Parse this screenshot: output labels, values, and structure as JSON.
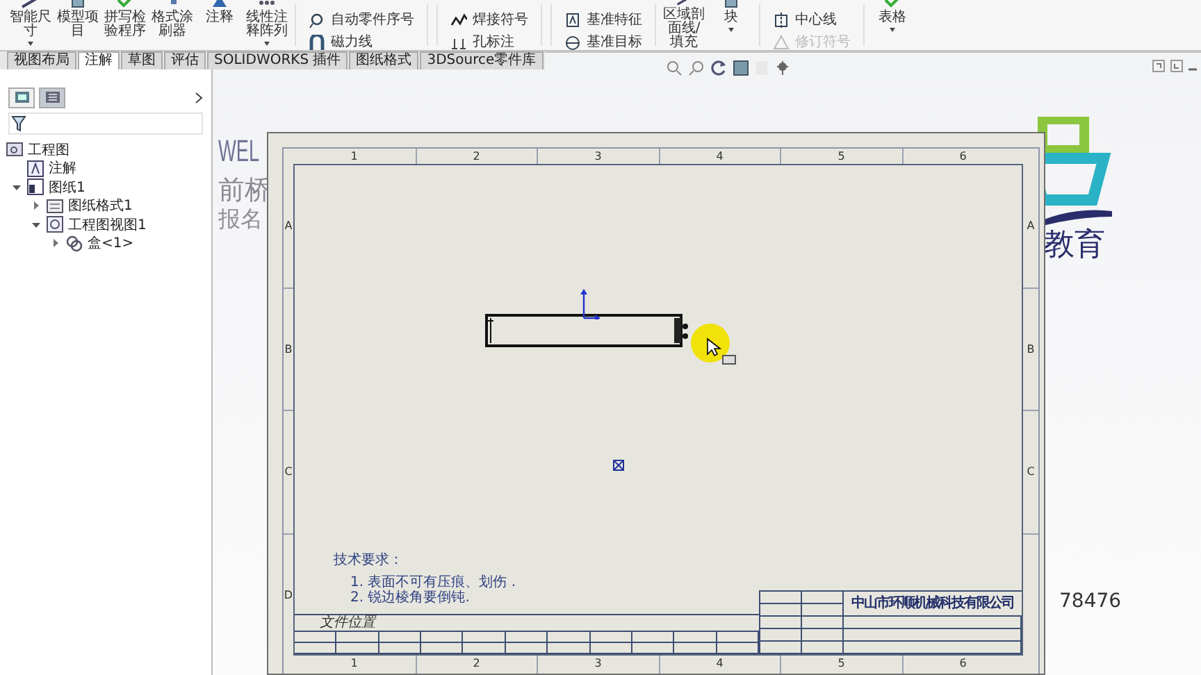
{
  "ribbon": [
    {
      "kind": "large",
      "label": "智能尺寸",
      "dropdown": true
    },
    {
      "kind": "large",
      "label": "模型项目",
      "dropdown": false
    },
    {
      "kind": "large",
      "label": "拼写检验程序",
      "dropdown": false
    },
    {
      "kind": "large",
      "label": "格式涂刷器",
      "dropdown": false
    },
    {
      "kind": "large",
      "label": "注释",
      "dropdown": false
    },
    {
      "kind": "large",
      "label": "线性注释阵列",
      "dropdown": true
    },
    {
      "kind": "stack",
      "items": [
        {
          "label": "自动零件序号",
          "disabled": false
        },
        {
          "label": "磁力线",
          "disabled": false
        }
      ]
    },
    {
      "kind": "stack",
      "items": [
        {
          "label": "焊接符号",
          "disabled": false
        },
        {
          "label": "孔标注",
          "disabled": false
        }
      ]
    },
    {
      "kind": "stack",
      "items": [
        {
          "label": "基准特征",
          "disabled": false
        },
        {
          "label": "基准目标",
          "disabled": false
        }
      ]
    },
    {
      "kind": "large",
      "label": "区域剖面线/填充",
      "dropdown": false
    },
    {
      "kind": "large",
      "label": "块",
      "dropdown": true
    },
    {
      "kind": "stack",
      "items": [
        {
          "label": "中心线",
          "disabled": false
        },
        {
          "label": "修订符号",
          "disabled": true
        }
      ]
    },
    {
      "kind": "large",
      "label": "表格",
      "dropdown": true
    }
  ],
  "tabs": [
    {
      "label": "视图布局",
      "selected": false
    },
    {
      "label": "注解",
      "selected": true
    },
    {
      "label": "草图",
      "selected": false
    },
    {
      "label": "评估",
      "selected": false
    },
    {
      "label": "SOLIDWORKS 插件",
      "selected": false
    },
    {
      "label": "图纸格式",
      "selected": false
    },
    {
      "label": "3DSource零件库",
      "selected": false
    }
  ],
  "panel": {
    "tabs": [
      {
        "selected": false
      },
      {
        "selected": true
      }
    ]
  },
  "tree": [
    {
      "label": "工程图",
      "kind": "drawing",
      "children": [
        {
          "label": "注解",
          "kind": "annotations"
        },
        {
          "label": "图纸1",
          "kind": "sheet",
          "expanded": true,
          "children": [
            {
              "label": "图纸格式1",
              "kind": "sheet_format",
              "expanded": false
            },
            {
              "label": "工程图视图1",
              "kind": "view",
              "expanded": true,
              "children": [
                {
                  "label": "盒<1>",
                  "kind": "part",
                  "expanded": false
                }
              ]
            }
          ]
        }
      ]
    }
  ],
  "background": {
    "texts": [
      "WEL",
      "前桥",
      "报名"
    ],
    "logo_text": "教育",
    "contact": "78476"
  },
  "sheet": {
    "top_columns": [
      "1",
      "2",
      "3",
      "4",
      "5",
      "6"
    ],
    "left_rows": [
      "A",
      "B",
      "C",
      "D"
    ],
    "right_rows": [
      "A",
      "B",
      "C"
    ],
    "bottom_columns": [
      "1",
      "2",
      "3",
      "4",
      "5",
      "6"
    ],
    "notes": {
      "title": "技术要求：",
      "items": [
        "1. 表面不可有压痕、划伤 .",
        "2. 锐边棱角要倒钝."
      ]
    },
    "file_location_label": "文件位置",
    "company": "中山市环顺机械科技有限公司"
  }
}
